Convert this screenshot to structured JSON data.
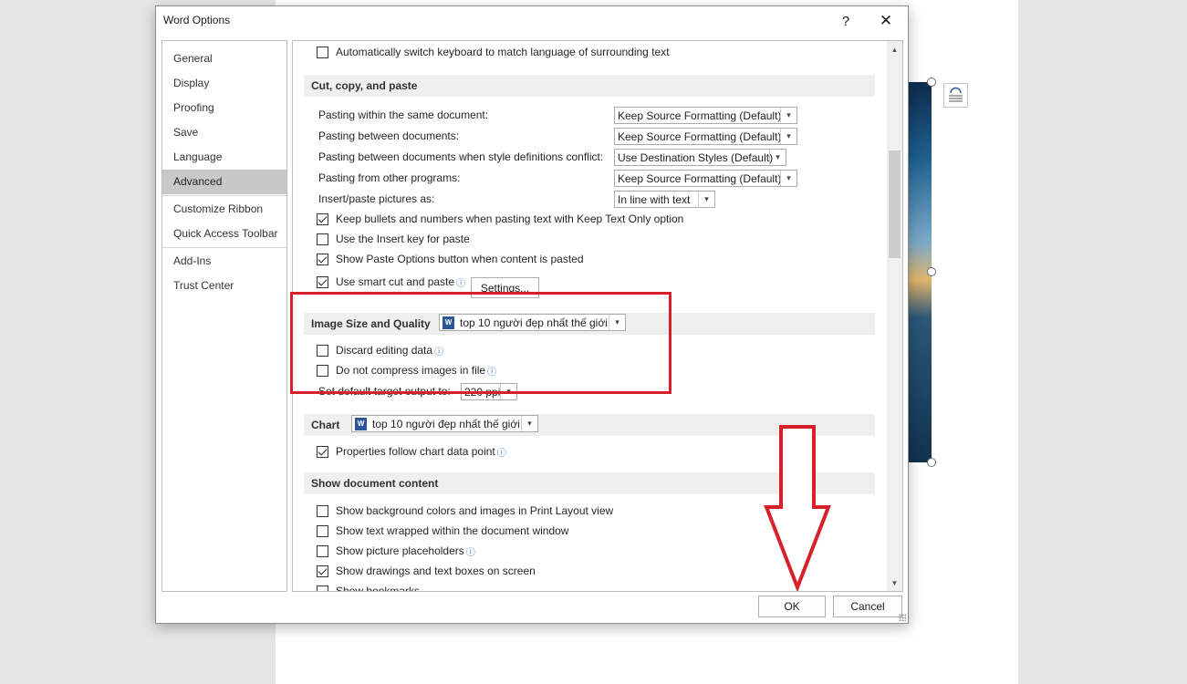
{
  "dialog": {
    "title": "Word Options",
    "help_glyph": "?",
    "close_glyph": "✕"
  },
  "nav": {
    "items": [
      {
        "label": "General"
      },
      {
        "label": "Display"
      },
      {
        "label": "Proofing"
      },
      {
        "label": "Save"
      },
      {
        "label": "Language"
      },
      {
        "label": "Advanced",
        "active": true
      },
      {
        "label": "Customize Ribbon"
      },
      {
        "label": "Quick Access Toolbar"
      },
      {
        "label": "Add-Ins"
      },
      {
        "label": "Trust Center"
      }
    ]
  },
  "content": {
    "top_option": {
      "label": "Automatically switch keyboard to match language of surrounding text",
      "checked": false
    },
    "cut_copy_paste": {
      "heading": "Cut, copy, and paste",
      "paste_rows": [
        {
          "label": "Pasting within the same document:",
          "value": "Keep Source Formatting (Default)"
        },
        {
          "label": "Pasting between documents:",
          "value": "Keep Source Formatting (Default)"
        },
        {
          "label": "Pasting between documents when style definitions conflict:",
          "value": "Use Destination Styles (Default)"
        },
        {
          "label": "Pasting from other programs:",
          "value": "Keep Source Formatting (Default)"
        },
        {
          "label": "Insert/paste pictures as:",
          "value": "In line with text"
        }
      ],
      "checkboxes": [
        {
          "label": "Keep bullets and numbers when pasting text with Keep Text Only option",
          "checked": true
        },
        {
          "label": "Use the Insert key for paste",
          "checked": false
        },
        {
          "label": "Show Paste Options button when content is pasted",
          "checked": true
        },
        {
          "label": "Use smart cut and paste",
          "checked": true
        }
      ],
      "settings_button": "Settings..."
    },
    "image_quality": {
      "heading": "Image Size and Quality",
      "document": "top 10 người đẹp nhất thế giới",
      "discard_editing": {
        "label": "Discard editing data",
        "checked": false
      },
      "no_compress": {
        "label": "Do not compress images in file",
        "checked": false
      },
      "target_output_label": "Set default target output to:",
      "target_output_value": "220 ppi"
    },
    "chart": {
      "heading": "Chart",
      "document": "top 10 người đẹp nhất thế giới",
      "follow_point": {
        "label": "Properties follow chart data point",
        "checked": true
      }
    },
    "show_content": {
      "heading": "Show document content",
      "items": [
        {
          "label": "Show background colors and images in Print Layout view",
          "checked": false
        },
        {
          "label": "Show text wrapped within the document window",
          "checked": false
        },
        {
          "label": "Show picture placeholders",
          "checked": false,
          "info": true
        },
        {
          "label": "Show drawings and text boxes on screen",
          "checked": true
        },
        {
          "label": "Show bookmarks",
          "checked": false
        }
      ]
    }
  },
  "footer": {
    "ok_label": "OK",
    "cancel_label": "Cancel"
  },
  "icons": {
    "info": "ⓘ",
    "dropdown": "▾",
    "scroll_up": "▲",
    "scroll_down": "▼",
    "word_doc": "W"
  },
  "colors": {
    "annotation": "#d6202a",
    "accent": "#2b579a"
  }
}
